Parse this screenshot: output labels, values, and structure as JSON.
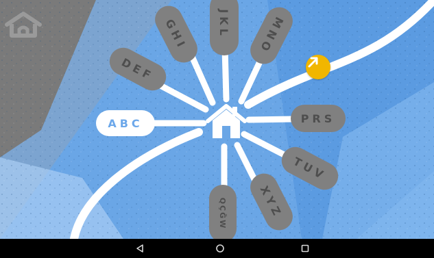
{
  "app": {
    "letter_groups": [
      {
        "label": "ABC",
        "selected": true
      },
      {
        "label": "DEF",
        "selected": false
      },
      {
        "label": "GHI",
        "selected": false
      },
      {
        "label": "JKL",
        "selected": false
      },
      {
        "label": "MNO",
        "selected": false
      },
      {
        "label": "PRS",
        "selected": false
      },
      {
        "label": "TUV",
        "selected": false
      },
      {
        "label": "XYZ",
        "selected": false
      },
      {
        "label": "QÇĞW",
        "selected": false
      }
    ],
    "icons": {
      "home_corner": "home-outline-icon",
      "center": "home-icon",
      "next": "arrow-up-right-icon"
    }
  },
  "nav_bar": {
    "buttons": [
      "back-triangle-icon",
      "home-circle-icon",
      "recents-square-icon"
    ]
  },
  "colors": {
    "background": "#6aa6e6",
    "pill": "#808080",
    "pill_text": "#4e4e4e",
    "pill_selected": "#ffffff",
    "accent": "#f1b600",
    "nav_bar": "#000000"
  }
}
